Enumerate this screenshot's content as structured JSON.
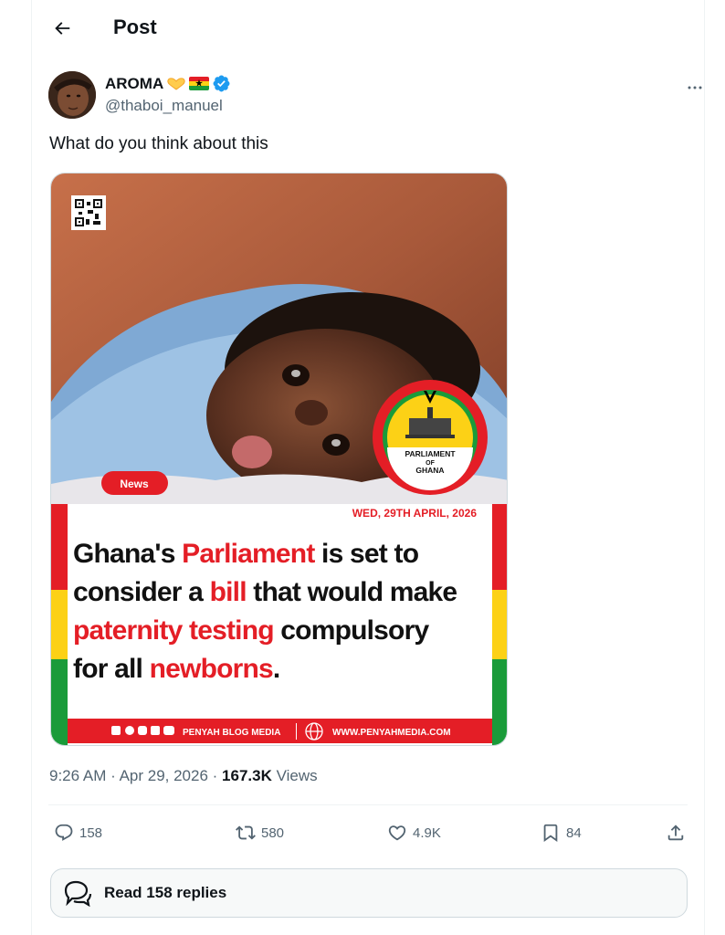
{
  "header": {
    "title": "Post",
    "back_icon": "arrow-left-icon"
  },
  "author": {
    "display_name": "AROMA",
    "handle": "@thaboi_manuel",
    "verified": true,
    "emojis": [
      "heart-hands-emoji",
      "ghana-flag-emoji"
    ]
  },
  "post": {
    "text": "What do you think about this"
  },
  "media": {
    "tag": "News",
    "date": "WED, 29TH APRIL, 2026",
    "seal_text": [
      "PARLIAMENT",
      "OF",
      "GHANA"
    ],
    "headline": [
      [
        {
          "t": "Ghana's ",
          "red": false
        },
        {
          "t": "Parliament",
          "red": true
        },
        {
          "t": " is set to",
          "red": false
        }
      ],
      [
        {
          "t": "consider a ",
          "red": false
        },
        {
          "t": "bill",
          "red": true
        },
        {
          "t": " that would make",
          "red": false
        }
      ],
      [
        {
          "t": "paternity testing",
          "red": true
        },
        {
          "t": " compulsory",
          "red": false
        }
      ],
      [
        {
          "t": "for all ",
          "red": false
        },
        {
          "t": "newborns",
          "red": true
        },
        {
          "t": ".",
          "red": false
        }
      ]
    ],
    "footer_brand": "PENYAH BLOG MEDIA",
    "footer_url": "WWW.PENYAHMEDIA.COM",
    "colors": {
      "red": "#e41e26",
      "yellow": "#fcd116",
      "green": "#1a9b3a"
    }
  },
  "meta": {
    "time": "9:26 AM",
    "date": "Apr 29, 2026",
    "views_count": "167.3K",
    "views_label": "Views"
  },
  "actions": {
    "replies": "158",
    "reposts": "580",
    "likes": "4.9K",
    "bookmarks": "84"
  },
  "read_replies": {
    "label": "Read 158 replies"
  }
}
